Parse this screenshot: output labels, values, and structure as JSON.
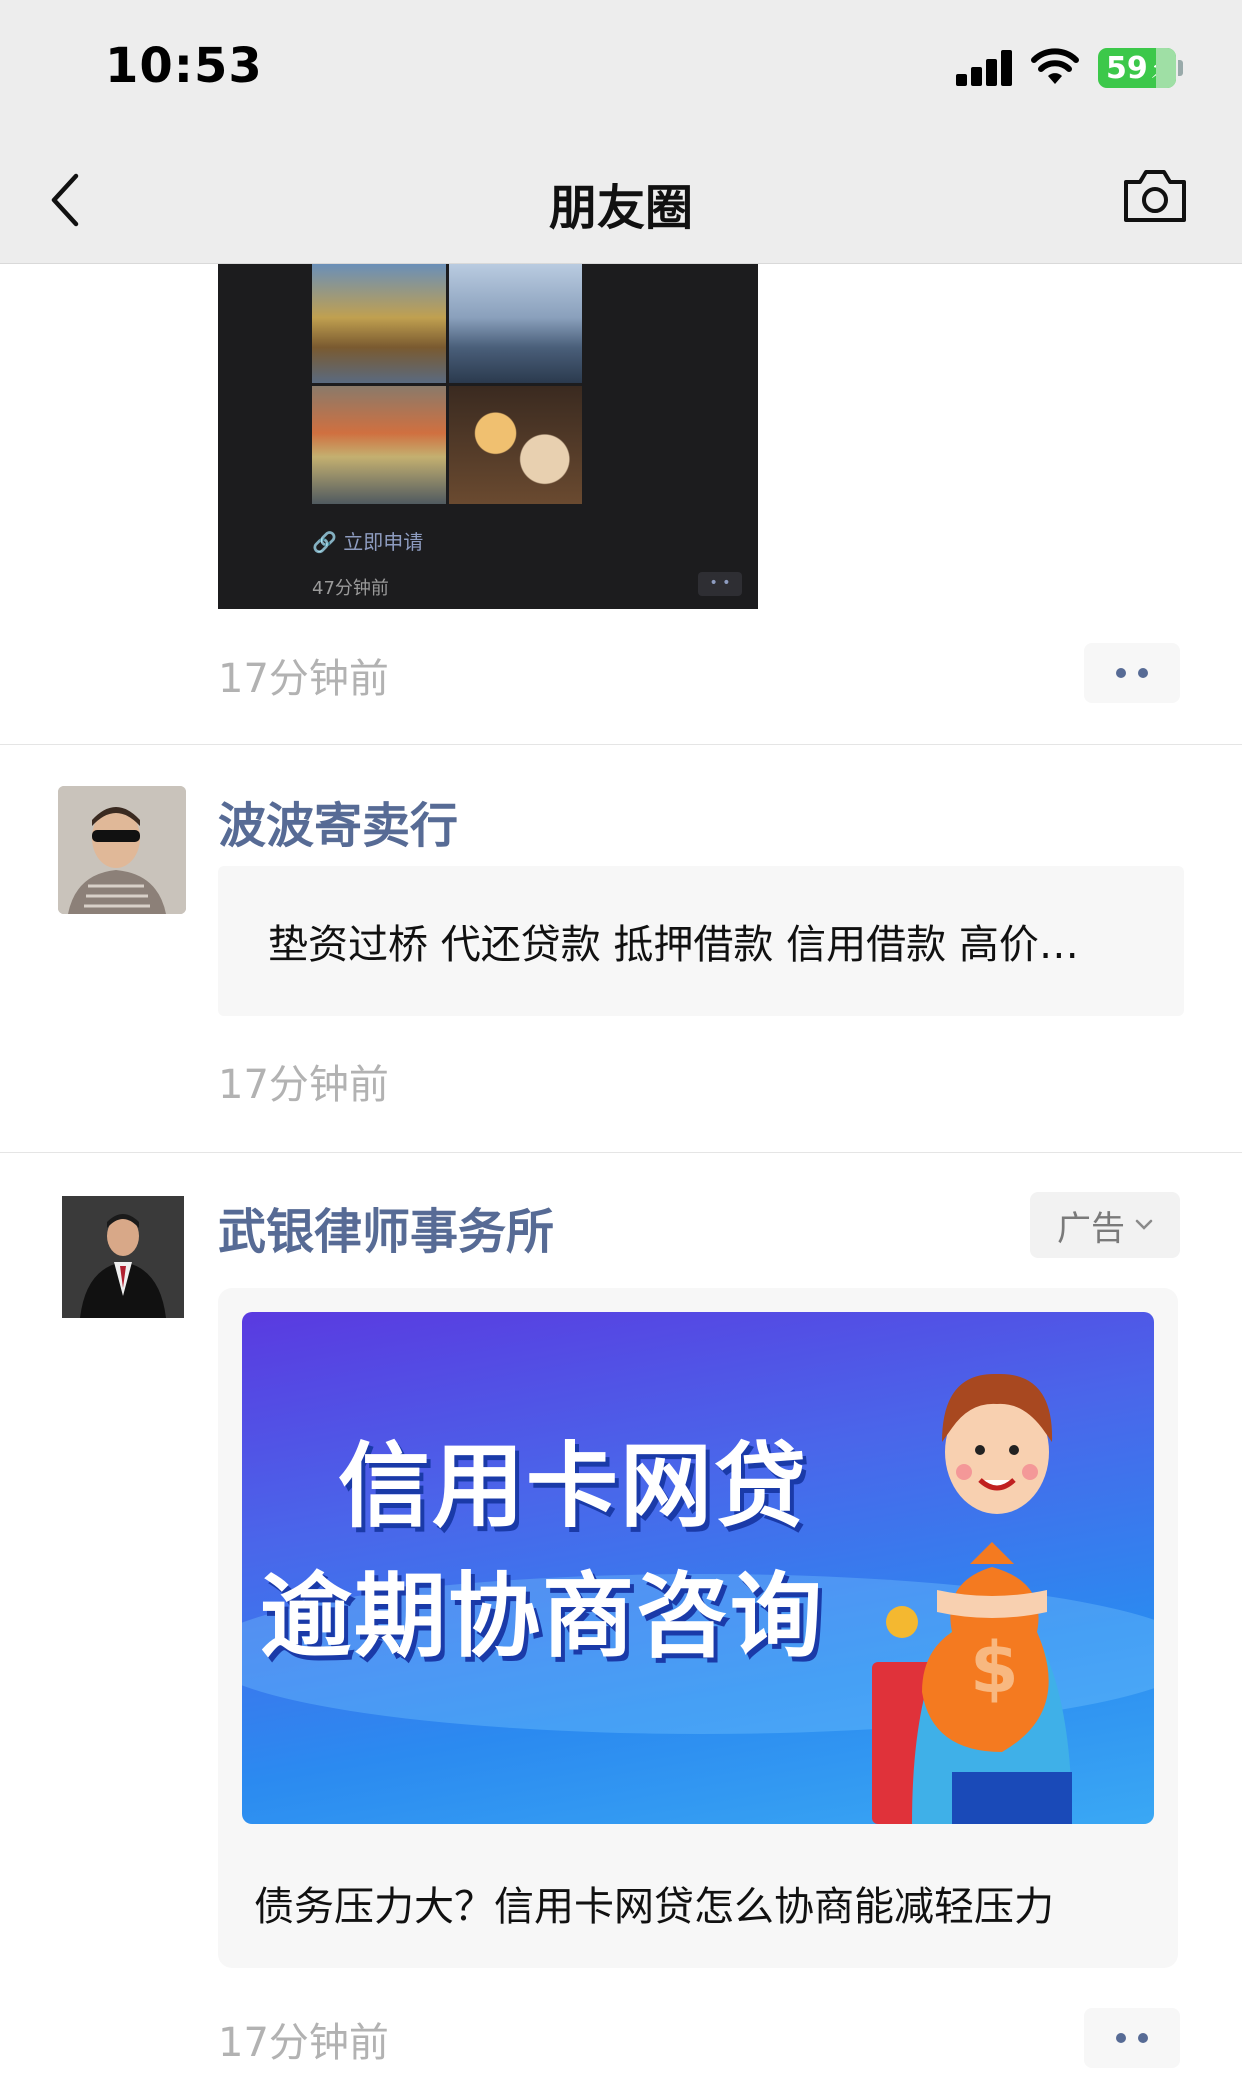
{
  "status_bar": {
    "time": "10:53",
    "battery_level": "59",
    "battery_fraction": 0.59,
    "charging": true,
    "signal_bars": 4,
    "wifi": true
  },
  "nav": {
    "title": "朋友圈",
    "back_icon": "chevron-left-icon",
    "camera_icon": "camera-icon"
  },
  "posts": [
    {
      "media": {
        "apply_link": "立即申请",
        "link_icon": "link-icon",
        "inner_time": "47分钟前"
      },
      "time": "17分钟前"
    },
    {
      "name": "波波寄卖行",
      "share_text": "垫资过桥 代还贷款 抵押借款 信用借款 高价…",
      "time": "17分钟前"
    },
    {
      "name": "武银律师事务所",
      "ad_label": "广告",
      "banner_line1": "信用卡网贷",
      "banner_line2": "逾期协商咨询",
      "caption": "债务压力大？信用卡网贷怎么协商能减轻压力",
      "time": "17分钟前"
    }
  ],
  "colors": {
    "nickname": "#576b95",
    "time": "#b2b2b2",
    "header_bg": "#ededed",
    "battery": "#3cc84a"
  }
}
